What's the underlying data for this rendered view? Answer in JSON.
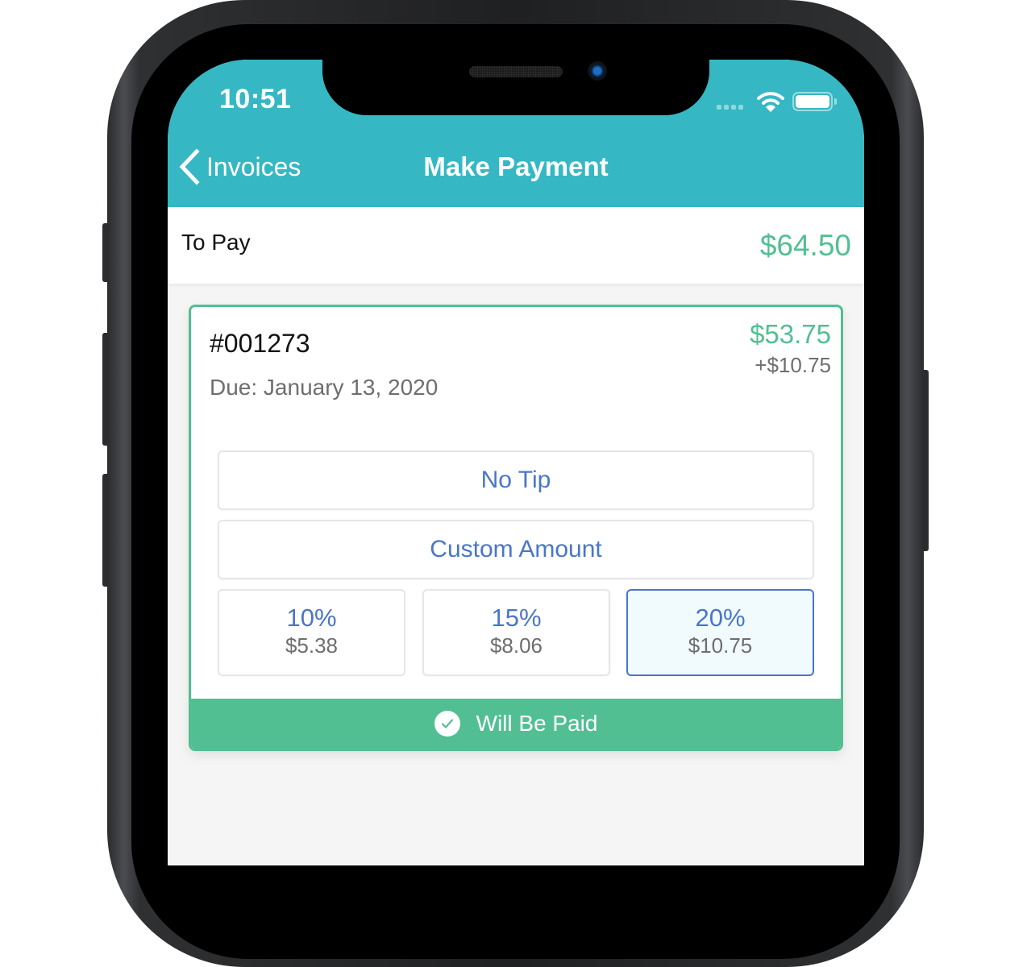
{
  "colors": {
    "header_bg": "#35b8c3",
    "accent_green": "#52bf93",
    "tip_blue": "#4a76c9",
    "muted_text": "#6e6e6e"
  },
  "status_bar": {
    "time": "10:51",
    "icons": [
      "cellular-signal-icon",
      "wifi-icon",
      "battery-icon"
    ]
  },
  "nav": {
    "back_label": "Invoices",
    "back_icon": "chevron-left-icon",
    "title": "Make Payment"
  },
  "summary": {
    "label": "To Pay",
    "amount": "$64.50"
  },
  "invoice": {
    "number": "#001273",
    "due": "Due: January 13, 2020",
    "amount": "$53.75",
    "tip": "+$10.75",
    "tip_options": {
      "no_tip": "No Tip",
      "custom": "Custom Amount",
      "percentages": [
        {
          "percent": "10%",
          "amount": "$5.38",
          "selected": false
        },
        {
          "percent": "15%",
          "amount": "$8.06",
          "selected": false
        },
        {
          "percent": "20%",
          "amount": "$10.75",
          "selected": true
        }
      ]
    },
    "status": {
      "icon": "check-circle-icon",
      "label": "Will Be Paid"
    }
  }
}
